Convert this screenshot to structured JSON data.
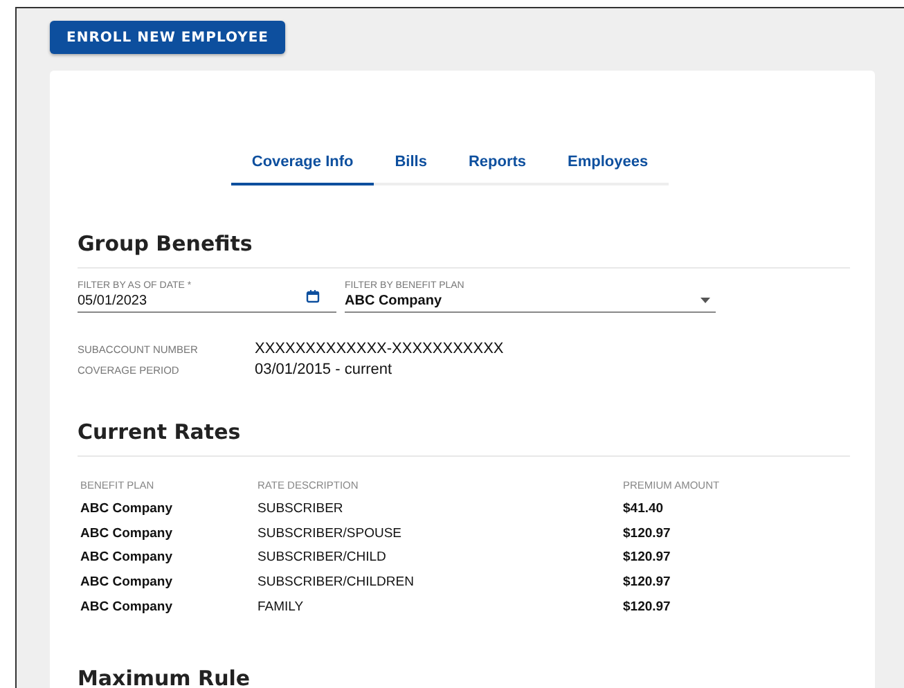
{
  "enroll_button": {
    "label": "ENROLL NEW EMPLOYEE"
  },
  "tabs": [
    {
      "label": "Coverage Info",
      "selected": true
    },
    {
      "label": "Bills",
      "selected": false
    },
    {
      "label": "Reports",
      "selected": false
    },
    {
      "label": "Employees",
      "selected": false
    }
  ],
  "group_benefits": {
    "title": "Group Benefits",
    "date_filter": {
      "label": "FILTER BY AS OF DATE *",
      "value": "05/01/2023"
    },
    "plan_filter": {
      "label": "FILTER BY BENEFIT PLAN",
      "value": "ABC Company"
    },
    "details": [
      {
        "label": "SUBACCOUNT NUMBER",
        "value": "XXXXXXXXXXXXX-XXXXXXXXXXX"
      },
      {
        "label": "COVERAGE PERIOD",
        "value": "03/01/2015 - current"
      }
    ]
  },
  "current_rates": {
    "title": "Current Rates",
    "columns": [
      "BENEFIT PLAN",
      "RATE DESCRIPTION",
      "PREMIUM AMOUNT"
    ],
    "rows": [
      [
        "ABC Company",
        "SUBSCRIBER",
        "$41.40"
      ],
      [
        "ABC Company",
        "SUBSCRIBER/SPOUSE",
        "$120.97"
      ],
      [
        "ABC Company",
        "SUBSCRIBER/CHILD",
        "$120.97"
      ],
      [
        "ABC Company",
        "SUBSCRIBER/CHILDREN",
        "$120.97"
      ],
      [
        "ABC Company",
        "FAMILY",
        "$120.97"
      ]
    ]
  },
  "maximum_rule": {
    "title": "Maximum Rule"
  }
}
